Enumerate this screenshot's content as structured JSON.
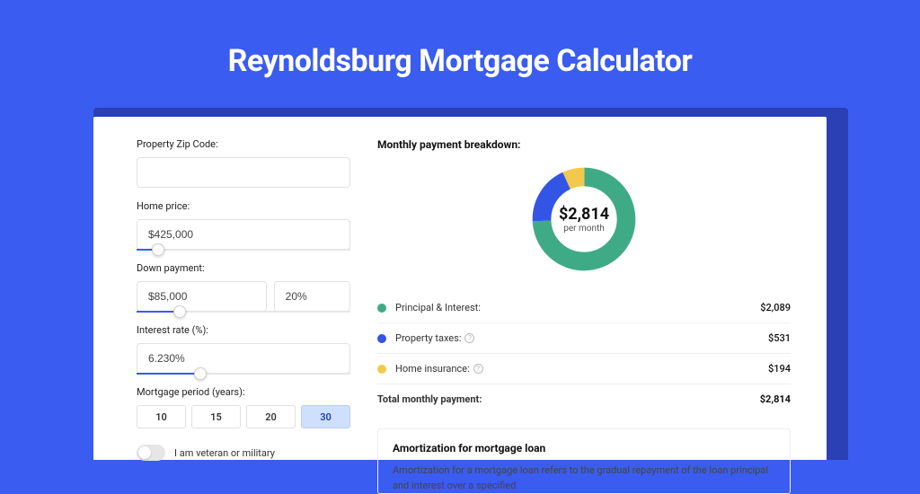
{
  "page_title": "Reynoldsburg Mortgage Calculator",
  "form": {
    "zip": {
      "label": "Property Zip Code:",
      "value": ""
    },
    "home_price": {
      "label": "Home price:",
      "value": "$425,000",
      "slider_pct": 10
    },
    "down_payment": {
      "label": "Down payment:",
      "amount": "$85,000",
      "percent": "20%",
      "slider_pct": 20
    },
    "interest": {
      "label": "Interest rate (%):",
      "value": "6.230%",
      "slider_pct": 30
    },
    "period": {
      "label": "Mortgage period (years):",
      "options": [
        "10",
        "15",
        "20",
        "30"
      ],
      "selected": "30"
    },
    "veteran": {
      "label": "I am veteran or military",
      "on": false
    }
  },
  "breakdown": {
    "title": "Monthly payment breakdown:",
    "center_amount": "$2,814",
    "center_sub": "per month",
    "items": [
      {
        "label": "Principal & Interest:",
        "amount": "$2,089",
        "value": 2089,
        "color": "#3fab86",
        "info": false
      },
      {
        "label": "Property taxes:",
        "amount": "$531",
        "value": 531,
        "color": "#3355e5",
        "info": true
      },
      {
        "label": "Home insurance:",
        "amount": "$194",
        "value": 194,
        "color": "#f2c94c",
        "info": true
      }
    ],
    "total": {
      "label": "Total monthly payment:",
      "amount": "$2,814"
    }
  },
  "chart_data": {
    "type": "pie",
    "title": "Monthly payment breakdown",
    "series": [
      {
        "name": "Principal & Interest",
        "value": 2089,
        "color": "#3fab86"
      },
      {
        "name": "Property taxes",
        "value": 531,
        "color": "#3355e5"
      },
      {
        "name": "Home insurance",
        "value": 194,
        "color": "#f2c94c"
      }
    ],
    "total": 2814,
    "center_label": "$2,814",
    "center_sublabel": "per month"
  },
  "amortization": {
    "title": "Amortization for mortgage loan",
    "text": "Amortization for a mortgage loan refers to the gradual repayment of the loan principal and interest over a specified"
  }
}
